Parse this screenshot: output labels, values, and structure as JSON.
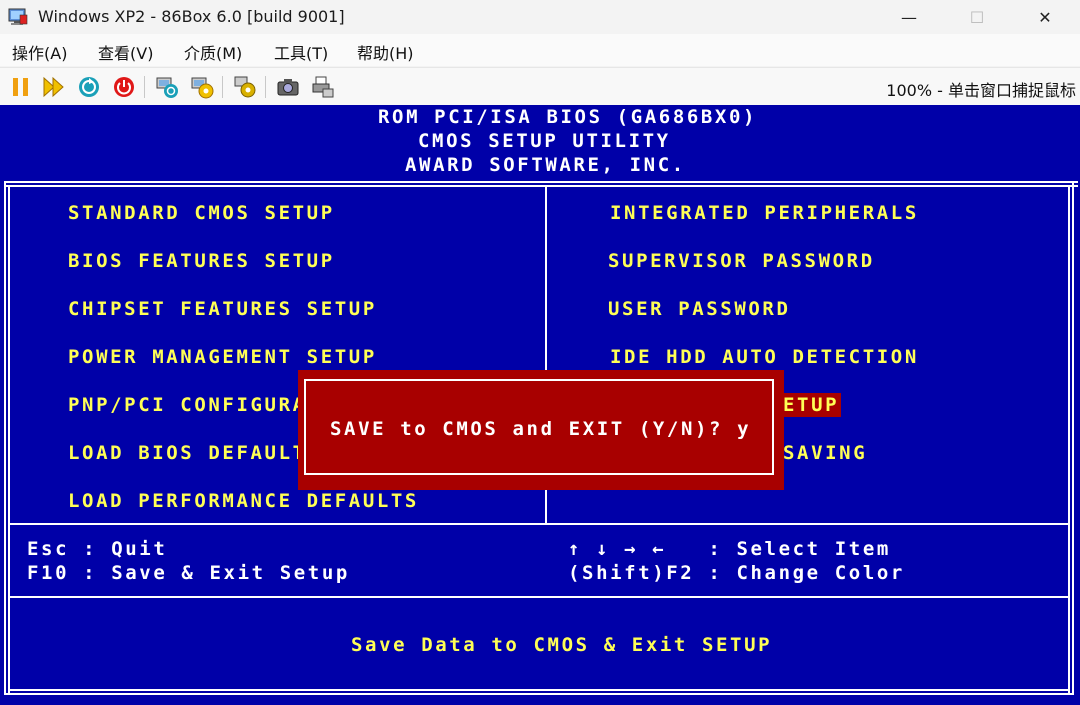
{
  "window": {
    "title": "Windows XP2 - 86Box 6.0 [build 9001]",
    "icon": "86box-monitor-icon",
    "controls": {
      "minimize": "—",
      "maximize": "☐",
      "close": "✕"
    }
  },
  "menu": [
    "操作(A)",
    "查看(V)",
    "介质(M)",
    "工具(T)",
    "帮助(H)"
  ],
  "toolbar": {
    "buttons": [
      "pause-icon",
      "fast-forward-icon",
      "reset-icon",
      "power-icon",
      "hard-reset-icon",
      "ctrl-alt-del-icon",
      "settings-icon",
      "screenshot-icon",
      "printer-icon"
    ],
    "status": "100% - 单击窗口捕捉鼠标"
  },
  "bios": {
    "header": [
      "ROM PCI/ISA BIOS (GA686BX0)",
      "CMOS SETUP UTILITY",
      "AWARD SOFTWARE, INC."
    ],
    "left_menu": [
      "STANDARD CMOS SETUP",
      "BIOS FEATURES SETUP",
      "CHIPSET FEATURES SETUP",
      "POWER MANAGEMENT SETUP",
      "PNP/PCI CONFIGURA",
      "LOAD BIOS DEFAULT",
      "LOAD PERFORMANCE DEFAULTS"
    ],
    "right_menu": [
      "INTEGRATED PERIPHERALS",
      "SUPERVISOR PASSWORD",
      "USER PASSWORD",
      "IDE HDD AUTO DETECTION",
      "ETUP",
      "SAVING"
    ],
    "help": {
      "esc": "Esc : Quit",
      "f10": "F10 : Save & Exit Setup",
      "arrows": "↑ ↓ → ←   : Select Item",
      "shift_f2": "(Shift)F2 : Change Color"
    },
    "status_line": "Save Data to CMOS & Exit SETUP",
    "dialog": "SAVE to CMOS and EXIT (Y/N)? y",
    "colors": {
      "background": "#0000a8",
      "menu_text": "#ffff55",
      "frame": "#ffffff",
      "dialog_bg": "#a80000"
    }
  }
}
